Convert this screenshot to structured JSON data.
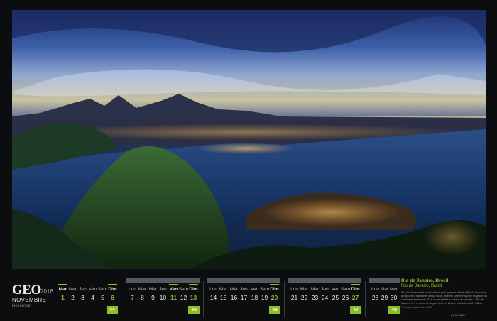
{
  "brand": {
    "logo": "GEO",
    "year": "2016",
    "month_fr": "NOVEMBRE",
    "month_en": "November"
  },
  "weeks": [
    {
      "number": "44",
      "days": [
        {
          "name": "Mar",
          "num": "1",
          "hl": true
        },
        {
          "name": "Mer",
          "num": "2",
          "hl": false
        },
        {
          "name": "Jeu",
          "num": "3",
          "hl": false
        },
        {
          "name": "Ven",
          "num": "4",
          "hl": false
        },
        {
          "name": "Sam",
          "num": "5",
          "hl": false
        },
        {
          "name": "Dim",
          "num": "6",
          "hl": true
        }
      ]
    },
    {
      "number": "45",
      "days": [
        {
          "name": "Lun",
          "num": "7",
          "hl": false
        },
        {
          "name": "Mar",
          "num": "8",
          "hl": false
        },
        {
          "name": "Mer",
          "num": "9",
          "hl": false
        },
        {
          "name": "Jeu",
          "num": "10",
          "hl": false
        },
        {
          "name": "Ven",
          "num": "11",
          "hl": true
        },
        {
          "name": "Sam",
          "num": "12",
          "hl": false
        },
        {
          "name": "Dim",
          "num": "13",
          "hl": true
        }
      ]
    },
    {
      "number": "46",
      "days": [
        {
          "name": "Lun",
          "num": "14",
          "hl": false
        },
        {
          "name": "Mar",
          "num": "15",
          "hl": false
        },
        {
          "name": "Mer",
          "num": "16",
          "hl": false
        },
        {
          "name": "Jeu",
          "num": "17",
          "hl": false
        },
        {
          "name": "Ven",
          "num": "18",
          "hl": false
        },
        {
          "name": "Sam",
          "num": "19",
          "hl": false
        },
        {
          "name": "Dim",
          "num": "20",
          "hl": true
        }
      ]
    },
    {
      "number": "47",
      "days": [
        {
          "name": "Lun",
          "num": "21",
          "hl": false
        },
        {
          "name": "Mar",
          "num": "22",
          "hl": false
        },
        {
          "name": "Mer",
          "num": "23",
          "hl": false
        },
        {
          "name": "Jeu",
          "num": "24",
          "hl": false
        },
        {
          "name": "Ven",
          "num": "25",
          "hl": false
        },
        {
          "name": "Sam",
          "num": "26",
          "hl": false
        },
        {
          "name": "Dim",
          "num": "27",
          "hl": true
        }
      ]
    },
    {
      "number": "48",
      "days": [
        {
          "name": "Lun",
          "num": "28",
          "hl": false
        },
        {
          "name": "Mar",
          "num": "29",
          "hl": false
        },
        {
          "name": "Mer",
          "num": "30",
          "hl": false
        }
      ]
    }
  ],
  "caption": {
    "title": "Rio de Janeiro, Brésil",
    "subtitle": "Rio de Janeiro, Brazil",
    "body": "Rio de Janeiro est la deuxième plus grande ville du Brésil. Avec ses 6 millions d'habitants intra-muros, elle est une métropole majeure du continent américain. Son nom signifie « rivière de janvier ».",
    "body_en": "Rio de Janeiro is the second largest town in Brazil, and with its 6 million inhabitants within its limits, it is a major metropolis of the American continent.",
    "credit": "© Getty Images/Cultura/AWL",
    "publisher": "LUMIGNE"
  },
  "accent_color": "#8bbf1e"
}
